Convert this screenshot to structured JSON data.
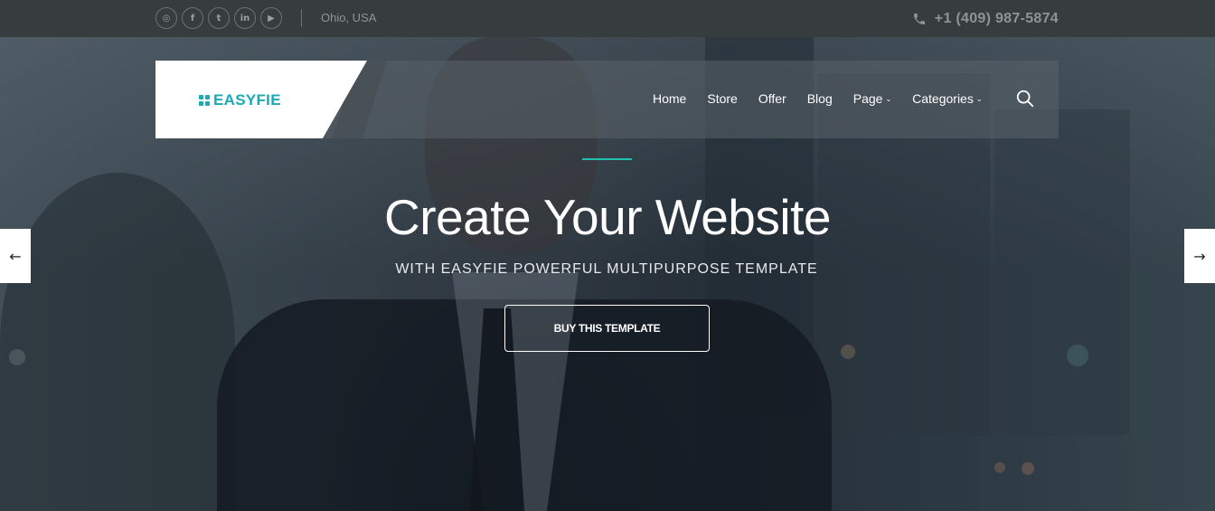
{
  "topbar": {
    "social_icons": [
      {
        "name": "instagram-icon",
        "glyph": "◎"
      },
      {
        "name": "facebook-icon",
        "glyph": "f"
      },
      {
        "name": "twitter-icon",
        "glyph": "t"
      },
      {
        "name": "linkedin-icon",
        "glyph": "in"
      },
      {
        "name": "youtube-icon",
        "glyph": "▶"
      }
    ],
    "location": "Ohio, USA",
    "phone": "+1 (409) 987-5874"
  },
  "nav": {
    "logo_text": "EASYFIE",
    "items": [
      {
        "label": "Home",
        "has_dropdown": false
      },
      {
        "label": "Store",
        "has_dropdown": false
      },
      {
        "label": "Offer",
        "has_dropdown": false
      },
      {
        "label": "Blog",
        "has_dropdown": false
      },
      {
        "label": "Page",
        "has_dropdown": true
      },
      {
        "label": "Categories",
        "has_dropdown": true
      }
    ],
    "search_icon": "search-icon"
  },
  "hero": {
    "title": "Create Your Website",
    "subtitle": "WITH EASYFIE POWERFUL MULTIPURPOSE TEMPLATE",
    "cta_label": "BUY THIS TEMPLATE",
    "prev_arrow": "←",
    "next_arrow": "→"
  },
  "colors": {
    "brand": "#1aa9b5",
    "accent_line": "#1fc0b0",
    "topbar_bg": "#373c3e"
  }
}
